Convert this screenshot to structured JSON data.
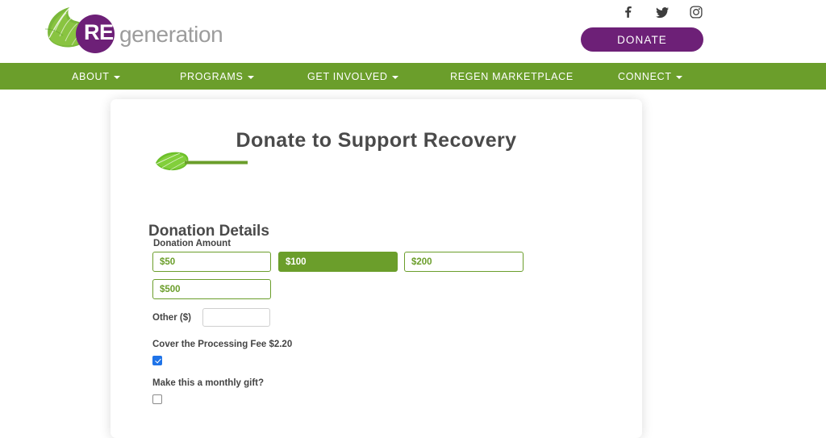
{
  "header": {
    "logo": {
      "mark_text": "RE",
      "word_text": "generation",
      "leaf_icon": "leaf-icon",
      "purple": "#6d2077",
      "gray": "#9c9c9c"
    },
    "social": [
      {
        "name": "facebook-icon",
        "label": "f"
      },
      {
        "name": "twitter-icon",
        "label": "twitter"
      },
      {
        "name": "instagram-icon",
        "label": "instagram"
      }
    ],
    "donate_label": "DONATE",
    "donate_color": "#6d2077"
  },
  "nav": {
    "background": "#6b9e2b",
    "items": [
      {
        "label": "ABOUT",
        "has_caret": true
      },
      {
        "label": "PROGRAMS",
        "has_caret": true
      },
      {
        "label": "GET INVOLVED",
        "has_caret": true
      },
      {
        "label": "REGEN MARKETPLACE",
        "has_caret": false
      },
      {
        "label": "CONNECT",
        "has_caret": true
      }
    ]
  },
  "card": {
    "title": "Donate to Support Recovery",
    "divider_icon": "leaf-divider-icon",
    "section_title": "Donation Details",
    "amount_label": "Donation Amount",
    "amount_options": [
      {
        "label": "$50",
        "selected": false
      },
      {
        "label": "$100",
        "selected": true
      },
      {
        "label": "$200",
        "selected": false
      },
      {
        "label": "$500",
        "selected": false
      }
    ],
    "other": {
      "label": "Other ($)",
      "value": "",
      "placeholder": ""
    },
    "processing_fee": {
      "label": "Cover the Processing Fee $2.20",
      "checked": true
    },
    "monthly_gift": {
      "label": "Make this a monthly gift?",
      "checked": false
    },
    "accent_green": "#6b9e2b",
    "checkbox_blue": "#1f73e8"
  }
}
